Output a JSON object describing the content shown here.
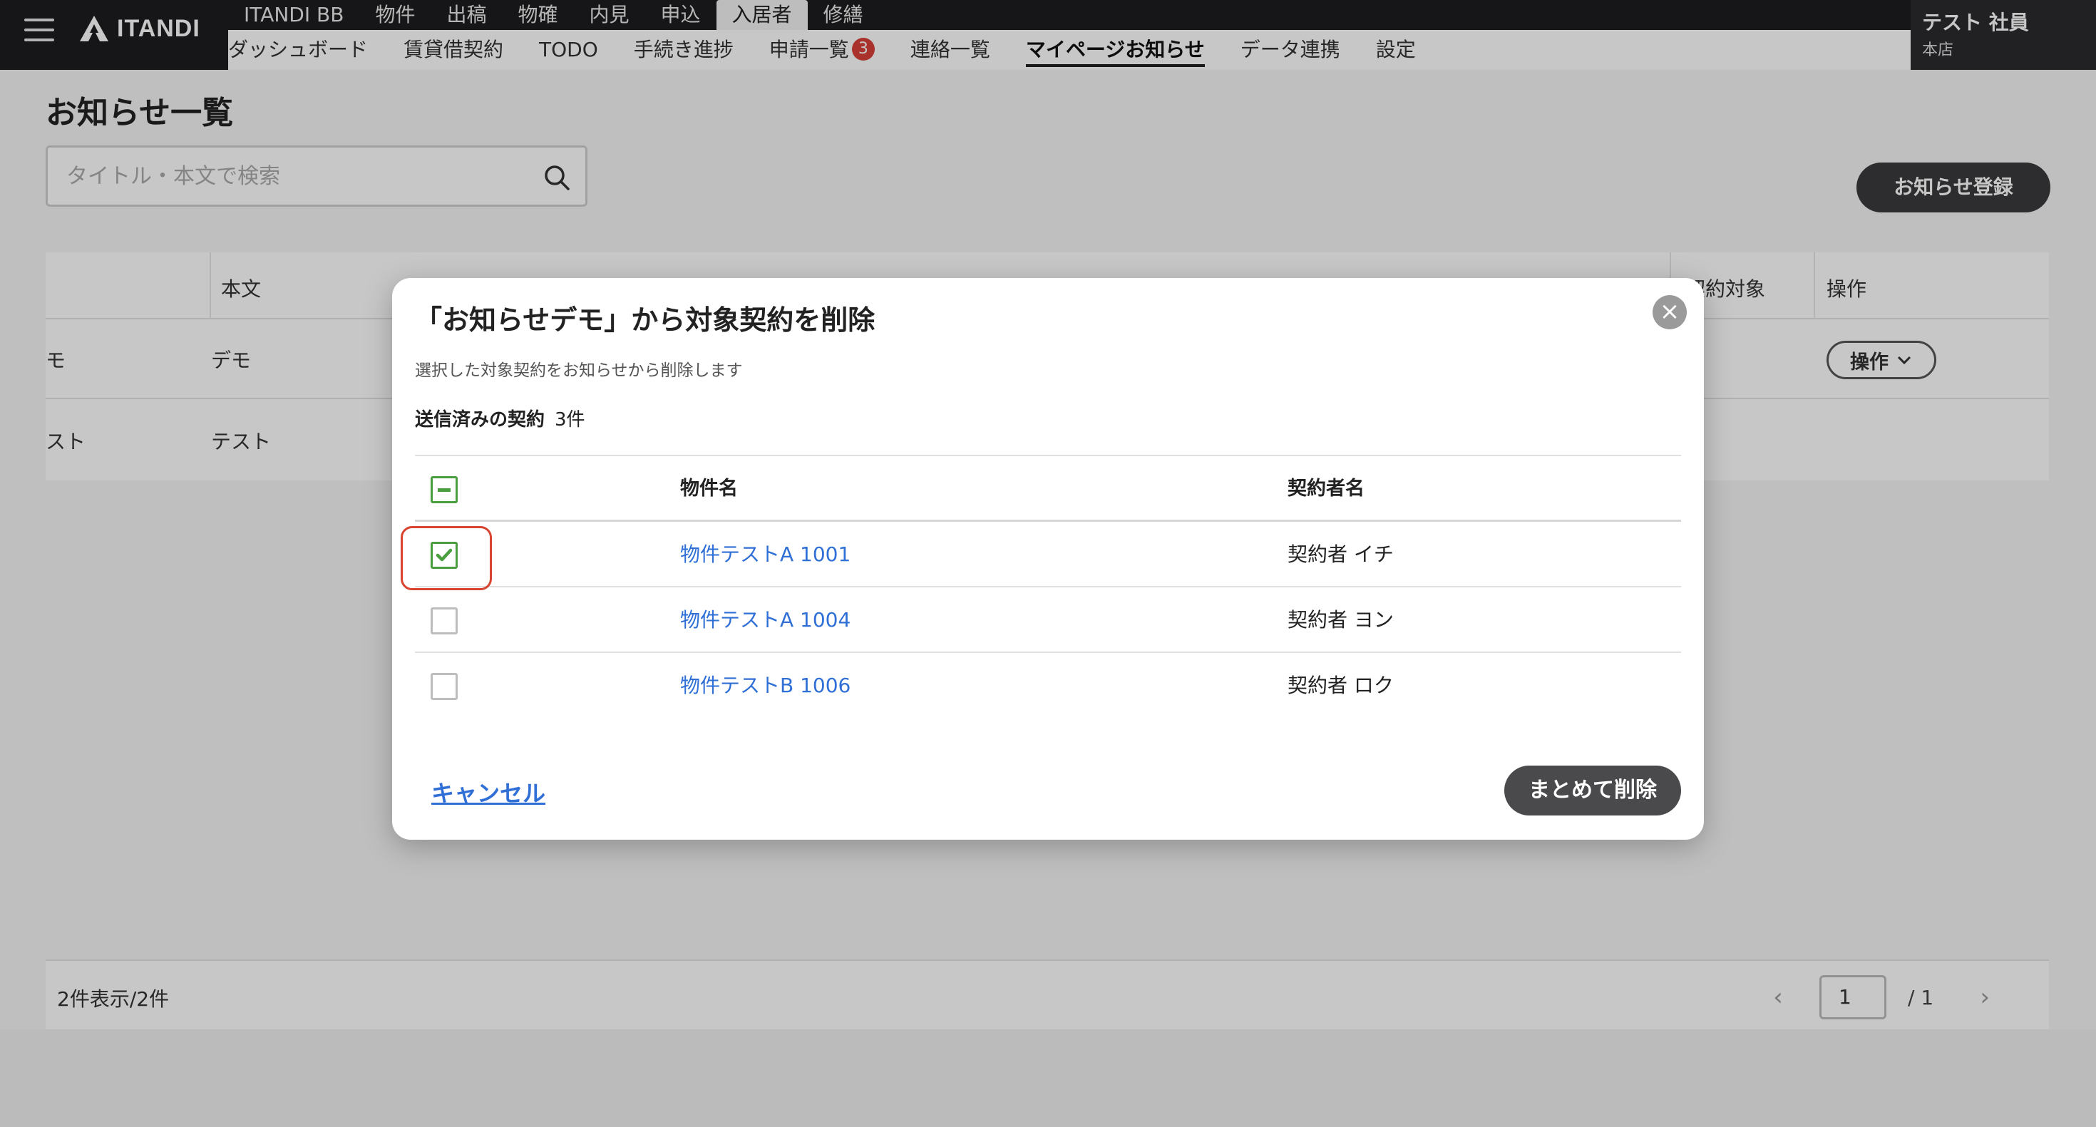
{
  "header": {
    "brand": "ITANDI",
    "service_nav": [
      "ITANDI BB",
      "物件",
      "出稿",
      "物確",
      "内見",
      "申込",
      "入居者",
      "修繕"
    ],
    "service_nav_active": "入居者",
    "sub_nav": [
      {
        "label": "ダッシュボード"
      },
      {
        "label": "賃貸借契約"
      },
      {
        "label": "TODO"
      },
      {
        "label": "手続き進捗"
      },
      {
        "label": "申請一覧",
        "badge": "3"
      },
      {
        "label": "連絡一覧"
      },
      {
        "label": "マイページお知らせ",
        "active": true
      },
      {
        "label": "データ連携"
      },
      {
        "label": "設定"
      }
    ],
    "user": {
      "name": "テスト 社員",
      "branch": "本店"
    }
  },
  "page": {
    "title": "お知らせ一覧",
    "search_placeholder": "タイトル・本文で検索",
    "register_button": "お知らせ登録",
    "table": {
      "headers": {
        "body": "本文",
        "target": "契約対象",
        "actions": "操作"
      },
      "rows": [
        {
          "title_fragment": "モ",
          "body": "デモ",
          "action": "操作"
        },
        {
          "title_fragment": "スト",
          "body": "テスト"
        }
      ]
    },
    "footer": {
      "count": "2件表示/2件",
      "page": "1",
      "total": "/ 1",
      "prev": "‹",
      "next": "›"
    }
  },
  "modal": {
    "title": "「お知らせデモ」から対象契約を削除",
    "description": "選択した対象契約をお知らせから削除します",
    "sent_label": "送信済みの契約",
    "sent_count": "3件",
    "columns": {
      "property": "物件名",
      "contractor": "契約者名"
    },
    "rows": [
      {
        "property": "物件テストA 1001",
        "contractor": "契約者 イチ",
        "checked": true
      },
      {
        "property": "物件テストA 1004",
        "contractor": "契約者 ヨン",
        "checked": false
      },
      {
        "property": "物件テストB 1006",
        "contractor": "契約者 ロク",
        "checked": false
      }
    ],
    "cancel": "キャンセル",
    "bulk_delete": "まとめて削除",
    "close_symbol": "×"
  },
  "colors": {
    "accent_green": "#4b9e3f",
    "link_blue": "#2f6fd6",
    "highlight_red": "#d8442f",
    "dark": "#1d1d1f"
  }
}
